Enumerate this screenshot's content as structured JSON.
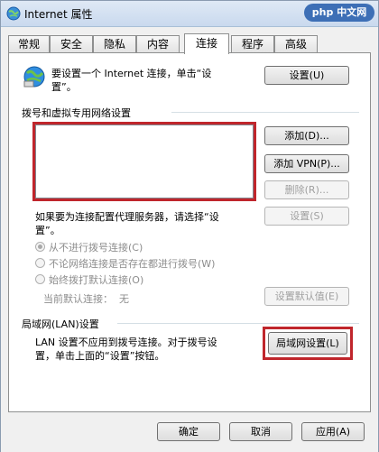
{
  "window": {
    "title": "Internet 属性",
    "watermark": "php 中文网"
  },
  "tabs": [
    "常规",
    "安全",
    "隐私",
    "内容",
    "连接",
    "程序",
    "高级"
  ],
  "active_tab": "连接",
  "setup": {
    "text_line1": "要设置一个 Internet 连接，单击“设",
    "text_line2": "置”。",
    "button": "设置(U)"
  },
  "dialup": {
    "heading": "拨号和虚拟专用网络设置",
    "add_button": "添加(D)...",
    "add_vpn_button": "添加 VPN(P)...",
    "delete_button": "删除(R)...",
    "proxy_text_line1": "如果要为连接配置代理服务器，请选择“设",
    "proxy_text_line2": "置”。",
    "settings_button": "设置(S)",
    "options": [
      "从不进行拨号连接(C)",
      "不论网络连接是否存在都进行拨号(W)",
      "始终拨打默认连接(O)"
    ],
    "current_default_label": "当前默认连接：",
    "current_default_value": "无",
    "set_default_button": "设置默认值(E)"
  },
  "lan": {
    "heading": "局域网(LAN)设置",
    "text_line1": "LAN 设置不应用到拨号连接。对于拨号设",
    "text_line2": "置，单击上面的“设置”按钮。",
    "button": "局域网设置(L)"
  },
  "footer": {
    "ok": "确定",
    "cancel": "取消",
    "apply": "应用(A)"
  },
  "colors": {
    "highlight": "#c0262c",
    "watermark_bg": "#3d6fb6"
  }
}
